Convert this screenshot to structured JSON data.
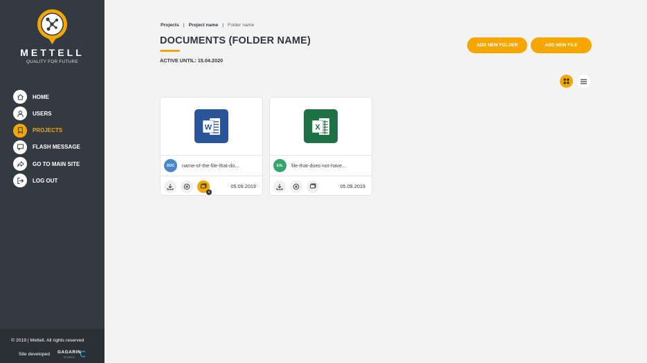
{
  "brand": {
    "name": "METTELL",
    "tagline": "QUALITY FOR FUTURE",
    "accent": "#f5a700"
  },
  "sidebar": {
    "items": [
      {
        "label": "HOME",
        "icon": "home-icon"
      },
      {
        "label": "USERS",
        "icon": "user-icon"
      },
      {
        "label": "PROJECTS",
        "icon": "bookmark-icon",
        "active": true
      },
      {
        "label": "FLASH MESSAGE",
        "icon": "message-icon"
      },
      {
        "label": "GO TO MAIN SITE",
        "icon": "share-icon"
      },
      {
        "label": "LOG OUT",
        "icon": "logout-icon"
      }
    ],
    "footer": {
      "copyright": "© 2019    |   Mettell. All rights reserved",
      "site_developed": "Site developed",
      "developer": "GAGARIN",
      "developer_sub": "STUDIO"
    }
  },
  "breadcrumb": {
    "items": [
      "Projects",
      "Project name",
      "Folder name"
    ],
    "separator": "|"
  },
  "header": {
    "title": "DOCUMENTS (FOLDER NAME)",
    "active_until": "ACTIVE UNTIL: 15.04.2020"
  },
  "toolbar": {
    "add_folder": "ADD NEW FOLDER",
    "add_file": "ADD NEW FILE"
  },
  "view": {
    "grid_icon": "grid-icon",
    "list_icon": "list-icon",
    "current": "grid"
  },
  "files": [
    {
      "type_badge": "DOC",
      "app_icon_letter": "W",
      "name": "name-of-the-file-that-do...",
      "date": "05.09.2019",
      "message_count": "1",
      "badge_color": "#4a87c8",
      "app_color": "#2a5599"
    },
    {
      "type_badge": "EXL",
      "app_icon_letter": "X",
      "name": "file-that-does-not-have...",
      "date": "05.09.2019",
      "message_count": "",
      "badge_color": "#36a46b",
      "app_color": "#1e7145"
    }
  ]
}
